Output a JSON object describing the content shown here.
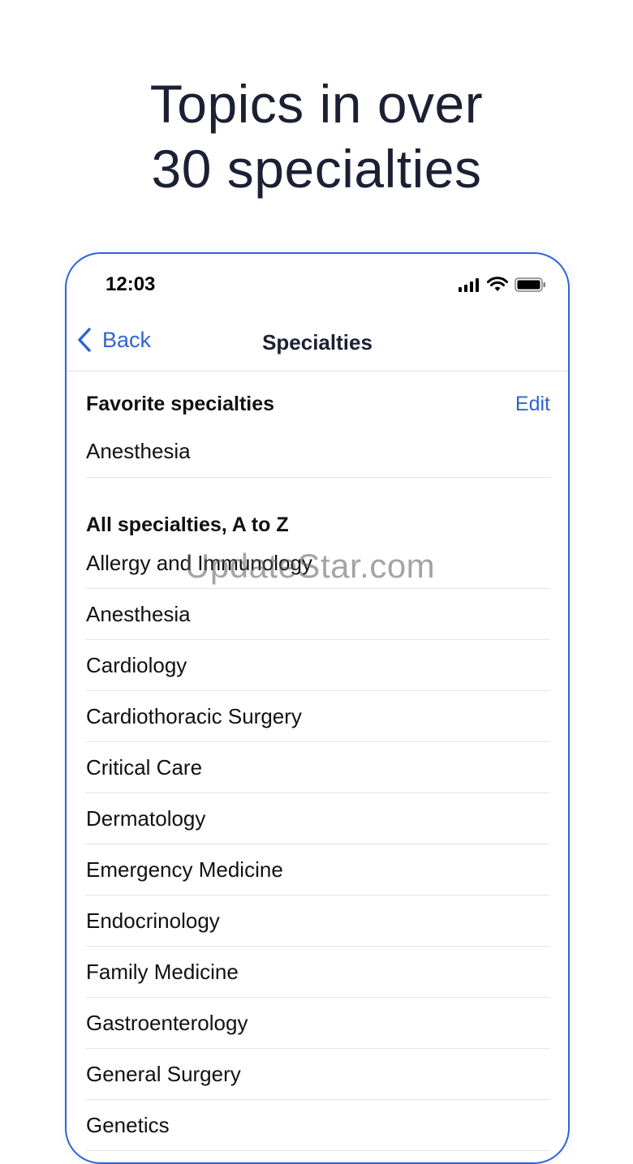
{
  "headline": {
    "line1": "Topics in over",
    "line2": "30 specialties"
  },
  "status_bar": {
    "time": "12:03"
  },
  "nav": {
    "back_label": "Back",
    "title": "Specialties"
  },
  "favorites": {
    "header": "Favorite specialties",
    "edit_label": "Edit",
    "items": [
      "Anesthesia"
    ]
  },
  "all": {
    "header": "All specialties, A to Z",
    "items": [
      "Allergy and Immunology",
      "Anesthesia",
      "Cardiology",
      "Cardiothoracic Surgery",
      "Critical Care",
      "Dermatology",
      "Emergency Medicine",
      "Endocrinology",
      "Family Medicine",
      "Gastroenterology",
      "General Surgery",
      "Genetics"
    ]
  },
  "watermark": "UpdateStar.com",
  "colors": {
    "accent": "#2f64d6",
    "text": "#1c2033",
    "divider": "#e3e3e6"
  },
  "icons": [
    "chevron-left-icon",
    "cellular-signal-icon",
    "wifi-icon",
    "battery-icon"
  ]
}
